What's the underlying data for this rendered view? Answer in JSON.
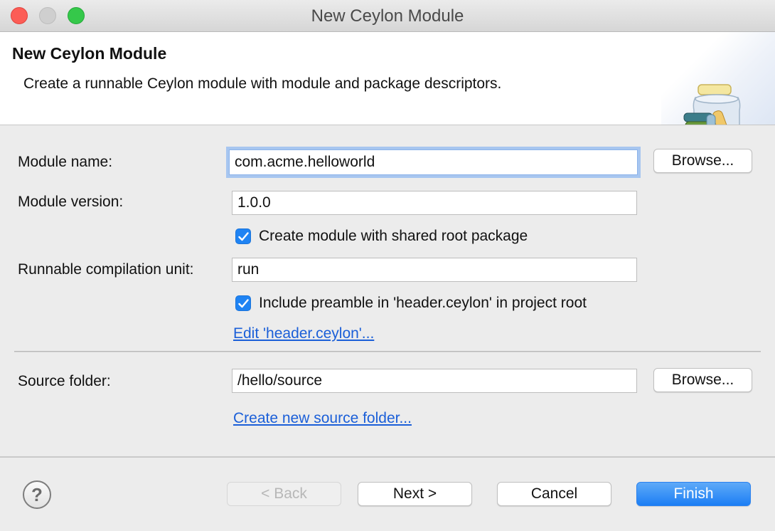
{
  "window": {
    "title": "New Ceylon Module"
  },
  "banner": {
    "title": "New Ceylon Module",
    "description": "Create a runnable Ceylon module with module and package descriptors.",
    "icon": "ceylon-module-jar-icon"
  },
  "form": {
    "module_name": {
      "label": "Module name:",
      "value": "com.acme.helloworld",
      "browse_label": "Browse..."
    },
    "module_version": {
      "label": "Module version:",
      "value": "1.0.0"
    },
    "shared_root_package": {
      "label": "Create module with shared root package",
      "checked": true
    },
    "compilation_unit": {
      "label": "Runnable compilation unit:",
      "value": "run"
    },
    "include_preamble": {
      "label": "Include preamble in 'header.ceylon' in project root",
      "checked": true
    },
    "edit_header_link": "Edit 'header.ceylon'...",
    "source_folder": {
      "label": "Source folder:",
      "value": "/hello/source",
      "browse_label": "Browse..."
    },
    "create_source_folder_link": "Create new source folder..."
  },
  "footer": {
    "help_icon": "help-icon",
    "help_glyph": "?",
    "back_label": "< Back",
    "next_label": "Next >",
    "cancel_label": "Cancel",
    "finish_label": "Finish"
  },
  "colors": {
    "accent": "#1f83f3",
    "link": "#1b5fd8",
    "close": "#fc5d56",
    "maximize": "#35c84a"
  }
}
